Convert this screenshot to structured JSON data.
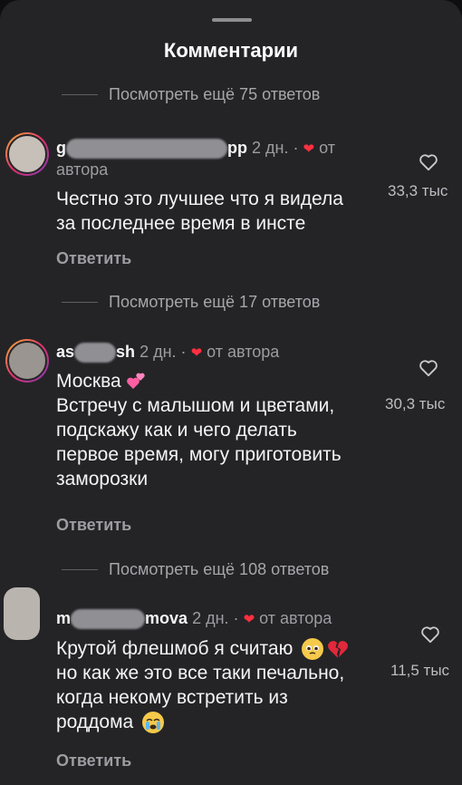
{
  "sheet": {
    "title": "Комментарии"
  },
  "threads": [
    {
      "more_replies": "Посмотреть ещё 75 ответов",
      "user_start": "g",
      "user_end": "pp",
      "time": "2 дн.",
      "dot": "·",
      "author_like_line1": "от",
      "author_like_line2": "автора",
      "text_line1": "Честно это лучшее что я видела",
      "text_line2": "за последнее время в инсте",
      "likes": "33,3 тыс",
      "reply": "Ответить"
    },
    {
      "more_replies": "Посмотреть ещё 17 ответов",
      "user_start": "as",
      "user_end": "sh",
      "time": "2 дн.",
      "dot": "·",
      "author_like": "от автора",
      "text_line1": "Москва",
      "text_line2": "Встречу с малышом и цветами,",
      "text_line3": "подскажу как и чего делать",
      "text_line4": "первое время, могу приготовить",
      "text_line5": "заморозки",
      "likes": "30,3 тыс",
      "reply": "Ответить"
    },
    {
      "more_replies": "Посмотреть ещё 108 ответов",
      "user_start": "m",
      "user_end": "mova",
      "time": "2 дн.",
      "dot": "·",
      "author_like": "от автора",
      "text_line1": "Крутой флешмоб я считаю",
      "text_line2": "но как же это все таки печально,",
      "text_line3": "когда некому встретить из",
      "text_line4": "роддома",
      "likes": "11,5 тыс",
      "reply": "Ответить"
    }
  ],
  "colors": {
    "background": "#242427",
    "heart": "#ff3040",
    "secondary_text": "#9c9ca1"
  }
}
